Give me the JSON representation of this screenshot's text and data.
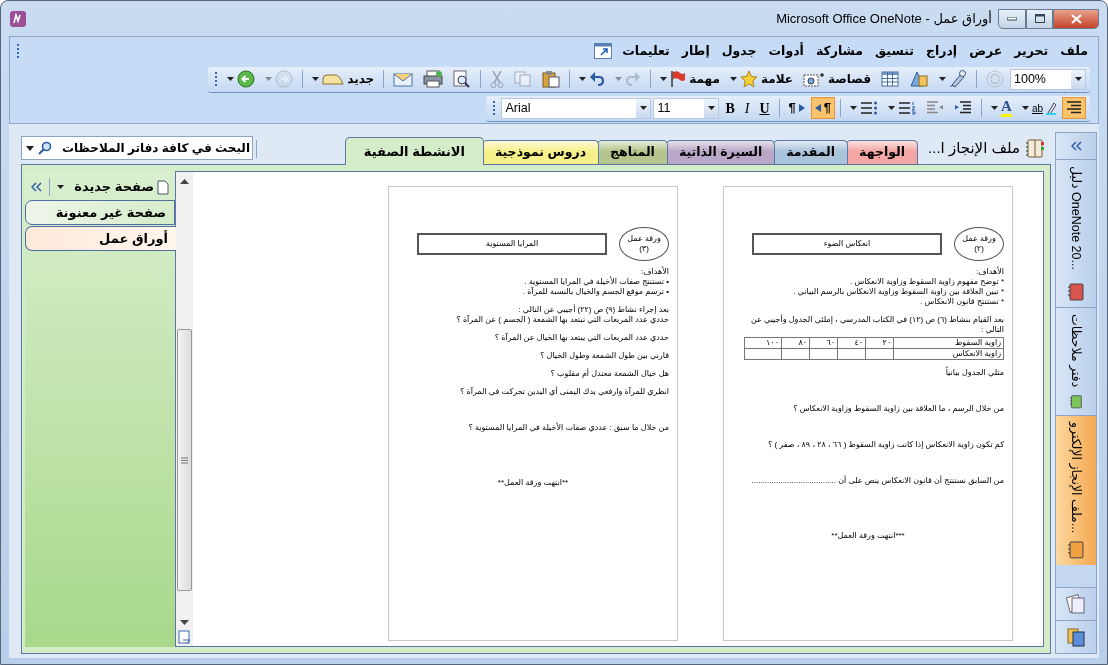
{
  "window": {
    "title": "Microsoft Office OneNote - أوراق عمل"
  },
  "menu": [
    "ملف",
    "تحرير",
    "عرض",
    "إدراج",
    "تنسيق",
    "مشاركة",
    "أدوات",
    "جدول",
    "إطار",
    "تعليمات"
  ],
  "standard_toolbar": [
    {
      "kind": "zoom",
      "label": "100%"
    },
    {
      "kind": "sync",
      "disabled": true
    },
    {
      "kind": "separator"
    },
    {
      "kind": "pen",
      "dropdown": true
    },
    {
      "kind": "shapes"
    },
    {
      "kind": "table"
    },
    {
      "kind": "clip",
      "label": "قصاصة"
    },
    {
      "kind": "star",
      "label": "علامة",
      "dropdown": true
    },
    {
      "kind": "flag",
      "label": "مهمة",
      "dropdown": true
    },
    {
      "kind": "separator"
    },
    {
      "kind": "redo",
      "disabled": true,
      "dropdown": true
    },
    {
      "kind": "undo",
      "dropdown": true
    },
    {
      "kind": "separator"
    },
    {
      "kind": "paste"
    },
    {
      "kind": "copy",
      "disabled": true
    },
    {
      "kind": "cut",
      "disabled": true
    },
    {
      "kind": "separator"
    },
    {
      "kind": "preview"
    },
    {
      "kind": "print"
    },
    {
      "kind": "mail"
    },
    {
      "kind": "separator"
    },
    {
      "kind": "new",
      "label": "جديد",
      "dropdown": true
    },
    {
      "kind": "separator"
    },
    {
      "kind": "forward",
      "disabled": true,
      "dropdown": true
    },
    {
      "kind": "back",
      "dropdown": true
    }
  ],
  "formatting_toolbar": [
    {
      "kind": "align",
      "pressed": true
    },
    {
      "kind": "highlight",
      "label": "ab",
      "dropdown": true
    },
    {
      "kind": "fontcolor",
      "label": "A",
      "dropdown": true
    },
    {
      "kind": "separator"
    },
    {
      "kind": "indent",
      "pressed": false
    },
    {
      "kind": "outdent",
      "pressed": false
    },
    {
      "kind": "numbering",
      "dropdown": true
    },
    {
      "kind": "bullets",
      "dropdown": true
    },
    {
      "kind": "separator"
    },
    {
      "kind": "rtl",
      "label": "¶",
      "pressed": true
    },
    {
      "kind": "ltr",
      "label": "¶",
      "pressed": false
    },
    {
      "kind": "separator"
    },
    {
      "kind": "underline",
      "label": "U",
      "pressed": false
    },
    {
      "kind": "italic",
      "label": "I",
      "pressed": false
    },
    {
      "kind": "bold",
      "label": "B",
      "pressed": false
    },
    {
      "kind": "size",
      "label": "11"
    },
    {
      "kind": "font",
      "label": "Arial"
    }
  ],
  "notebook": {
    "title": "ملف الإنجاز ا...",
    "sections": [
      {
        "label": "الواجهة",
        "color": "#f4a6a5",
        "selected": false
      },
      {
        "label": "المقدمة",
        "color": "#a9c3db",
        "selected": false
      },
      {
        "label": "السيرة الذاتية",
        "color": "#b8a7c6",
        "selected": false
      },
      {
        "label": "المناهج",
        "color": "#b5c58d",
        "selected": false
      },
      {
        "label": "دروس نموذجية",
        "color": "#f6f08a",
        "selected": false
      },
      {
        "label": "الانشطة الصفية",
        "color": "#d5ecc9",
        "selected": true
      }
    ]
  },
  "search": {
    "placeholder": "البحث في كافة دفاتر الملاحظات"
  },
  "page_list": {
    "new_page": "صفحة جديدة",
    "pages": [
      {
        "title": "صفحة غير معنونة",
        "selected": false
      },
      {
        "title": "أوراق عمل",
        "selected": true
      }
    ]
  },
  "documents": [
    {
      "badge": "ورقة عمل (٢)",
      "title": "انعكاس الضوء",
      "lines": [
        {
          "kind": "line",
          "text": "الأهداف:"
        },
        {
          "kind": "line",
          "text": "* توضح مفهوم زاوية السقوط وزاوية الانعكاس ."
        },
        {
          "kind": "line",
          "text": "* تبين العلاقة بين زاوية السقوط وزاوية الانعكاس بالرسم البياني ."
        },
        {
          "kind": "line",
          "text": "* تستنتج قانون الانعكاس ."
        },
        {
          "kind": "para",
          "text": "بعد القيام بنشاط (٦) ص (١٢) في الكتاب المدرسي ، إملئي الجدول وأجيبي عن التالي :"
        },
        {
          "kind": "table",
          "rows": [
            [
              "زاوية السقوط",
              "٢٠",
              "٤٠",
              "٦٠",
              "٨٠",
              "١٠٠"
            ],
            [
              "زاوية الانعكاس"
            ]
          ]
        },
        {
          "kind": "para",
          "text": "مثلي الجدول بيانياً"
        },
        {
          "kind": "question",
          "text": "من خلال الرسم ، ما العلاقة بين زاوية السقوط وزاوية الانعكاس ؟"
        },
        {
          "kind": "question",
          "text": "كم تكون زاوية الانعكاس إذا كانت زاوية السقوط ( ٦٦ ، ٢٨ ، ٨٩ ، صفر ) ؟"
        },
        {
          "kind": "question",
          "text": "من السابق نستنتج أن قانون الانعكاس ينص على أن ......................................"
        },
        {
          "kind": "end",
          "text": "***انتهت ورقة العمل**"
        }
      ]
    },
    {
      "badge": "ورقة عمل (٣)",
      "title": "المرايا المستوية",
      "lines": [
        {
          "kind": "line",
          "text": "الأهداف:"
        },
        {
          "kind": "line",
          "text": "• تستنتج صفات الأخيلة في المرايا المستوية ."
        },
        {
          "kind": "line",
          "text": "• ترسم موقع الجسم والخيال بالنسبة للمرآة ."
        },
        {
          "kind": "para",
          "text": "بعد إجراء نشاط (٩) ص (٢٢) أجيبي عن التالي :"
        },
        {
          "kind": "line",
          "text": "حددي عدد المربعات التي تبتعد بها الشمعة ( الجسم ) عن المرآة ؟"
        },
        {
          "kind": "para",
          "text": "حددي عدد المربعات التي يبتعد بها الخيال عن المرآة ؟"
        },
        {
          "kind": "para",
          "text": "قارني بين طول الشمعة وطول الخيال ؟"
        },
        {
          "kind": "para",
          "text": "هل خيال الشمعة معتدل أم مقلوب ؟"
        },
        {
          "kind": "para",
          "text": "انظري للمرآة وارفعي يدك اليمنى أي اليدين تحركت في المرآة ؟"
        },
        {
          "kind": "question",
          "text": "من خلال ما سبق : عددي صفات الأخيلة في المرايا المستوية ؟"
        },
        {
          "kind": "end",
          "text": "**انتهت ورقة العمل**"
        }
      ]
    }
  ],
  "notebooks_bar": {
    "notebooks": [
      {
        "label": "دليل OneNote 20...",
        "color": "#d9534f",
        "selected": false
      },
      {
        "label": "دفتر ملاحظات",
        "color": "#7cc35a",
        "selected": false
      },
      {
        "label": "ملف الإنجاز الإلكترو...",
        "color": "#f0a040",
        "selected": true
      }
    ]
  }
}
